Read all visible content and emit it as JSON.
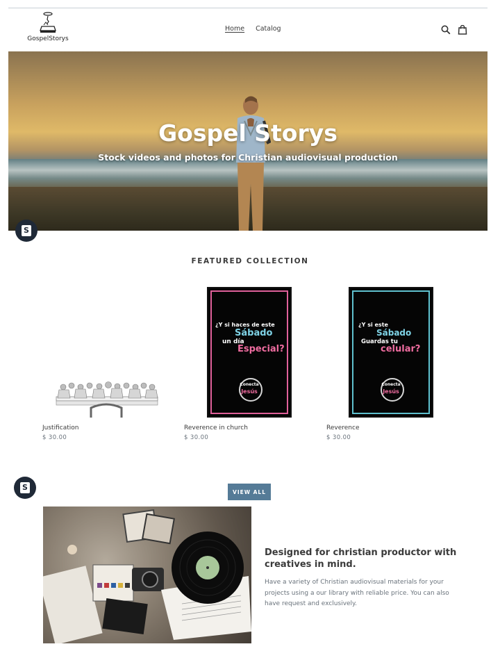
{
  "header": {
    "logo_text": "GospelStorys",
    "nav": [
      {
        "label": "Home",
        "active": true
      },
      {
        "label": "Catalog",
        "active": false
      }
    ],
    "icons": [
      "search-icon",
      "cart-icon"
    ]
  },
  "hero": {
    "title": "Gospel Storys",
    "subtitle": "Stock videos and photos for Christian audiovisual production"
  },
  "featured": {
    "title": "FEATURED COLLECTION",
    "products": [
      {
        "name": "Justification",
        "price": "$ 30.00"
      },
      {
        "name": "Reverence in church",
        "price": "$ 30.00",
        "poster": {
          "lines": [
            "¿Y si haces de este",
            "Sábado",
            "un día",
            "Especial?"
          ],
          "logo": [
            "Conecta",
            "Jesús"
          ],
          "frame_color": "#e0609a"
        }
      },
      {
        "name": "Reverence",
        "price": "$ 30.00",
        "poster": {
          "lines": [
            "¿Y si este",
            "Sábado",
            "Guardas tu",
            "celular?"
          ],
          "logo": [
            "Conecta",
            "Jesús"
          ],
          "frame_color": "#5fc1cf"
        }
      }
    ],
    "view_all": "VIEW ALL"
  },
  "feature": {
    "heading": "Designed for christian productor with creatives in mind.",
    "text": "Have a variety of Christian audiovisual materials for your projects using a our library with reliable price. You can also have request and exclusively."
  },
  "colors": {
    "accent": "#557b97",
    "text": "#3a3a3a",
    "muted": "#69727b",
    "badge": "#1f2937"
  }
}
